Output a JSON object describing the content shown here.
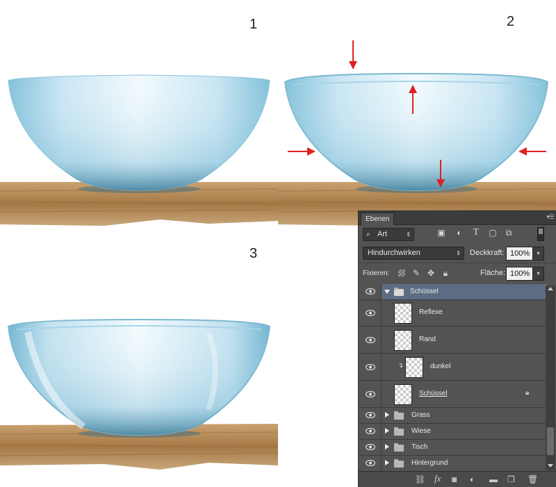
{
  "step_numbers": [
    "1",
    "2",
    "3"
  ],
  "layers_panel": {
    "tab_title": "Ebenen",
    "filter_kind": "Art",
    "blend_mode": "Hindurchwirken",
    "opacity_label": "Deckkraft:",
    "opacity_value": "100%",
    "lock_label": "Fixieren:",
    "fill_label": "Fläche:",
    "fill_value": "100%",
    "layers": [
      {
        "name": "Schüssel",
        "type": "group",
        "expanded": true,
        "selected": true
      },
      {
        "name": "Reflexe",
        "type": "layer"
      },
      {
        "name": "Rand",
        "type": "layer"
      },
      {
        "name": "dunkel",
        "type": "layer",
        "clipped": true
      },
      {
        "name": "Schüssel",
        "type": "layer",
        "locked": true,
        "underlined": true
      },
      {
        "name": "Grass",
        "type": "group",
        "expanded": false
      },
      {
        "name": "Wiese",
        "type": "group",
        "expanded": false
      },
      {
        "name": "Tisch",
        "type": "group",
        "expanded": false
      },
      {
        "name": "Hintergrund",
        "type": "group",
        "expanded": false
      }
    ],
    "icons": {
      "filter": [
        "image-filter-icon",
        "adjustment-filter-icon",
        "type-filter-icon",
        "shape-filter-icon",
        "smart-object-filter-icon"
      ],
      "lock": [
        "lock-transparent-icon",
        "lock-paint-icon",
        "lock-position-icon",
        "lock-all-icon"
      ],
      "bottom": [
        "link-layers-icon",
        "fx-icon",
        "mask-icon",
        "adjustment-layer-icon",
        "new-group-icon",
        "new-layer-icon",
        "delete-icon"
      ]
    },
    "selection_color": "#5c6c82",
    "fx_label": "fx"
  },
  "colors": {
    "bowl_light": "#dff1fb",
    "bowl_dark": "#5aa6c6",
    "wood": "#b08450",
    "arrow": "#e02020"
  }
}
